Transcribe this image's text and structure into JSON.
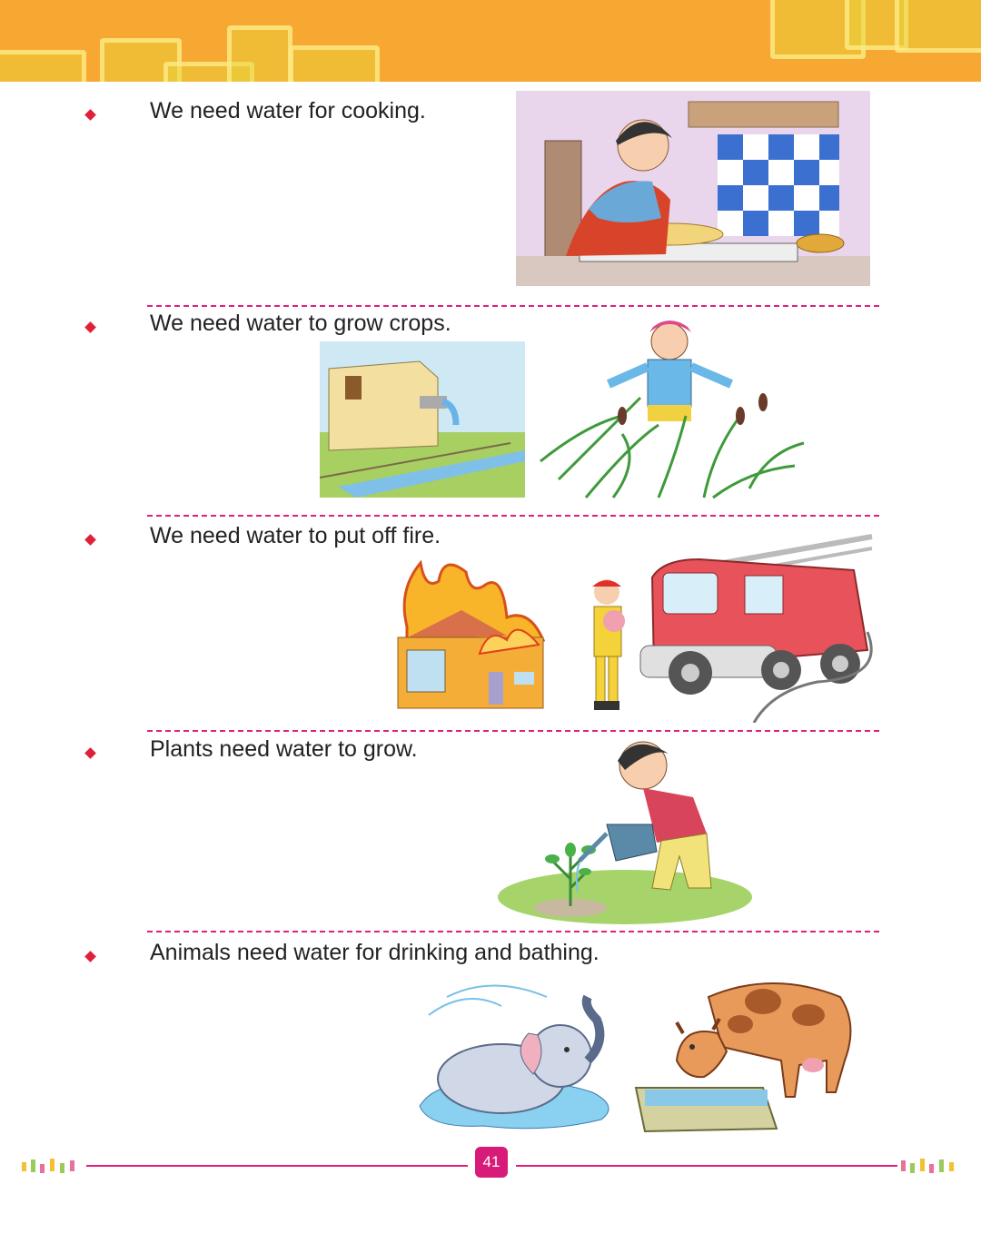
{
  "items": [
    {
      "text": "We need water for cooking."
    },
    {
      "text": "We need water to grow crops."
    },
    {
      "text": "We need water to put off fire."
    },
    {
      "text": "Plants need water to grow."
    },
    {
      "text": "Animals need water for drinking and bathing."
    }
  ],
  "footer": {
    "page_number": "41"
  },
  "colors": {
    "header": "#f7a832",
    "bullet": "#e0203a",
    "divider": "#e0207a",
    "page_badge": "#d81b78"
  }
}
